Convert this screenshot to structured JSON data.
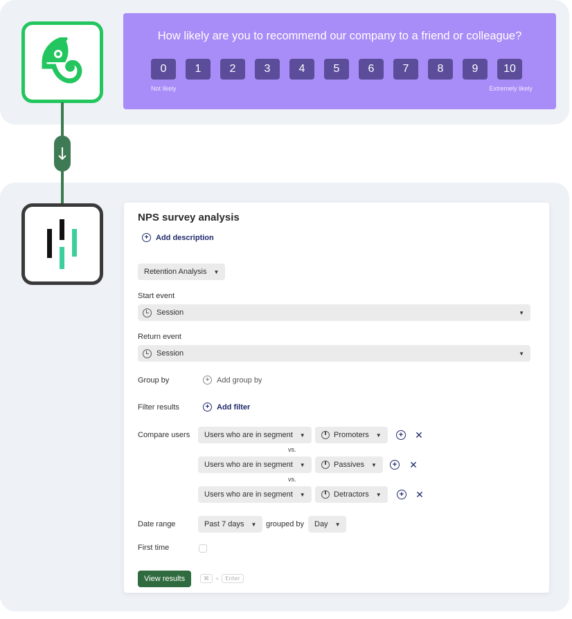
{
  "survey": {
    "question": "How likely are you to recommend our company to a friend or colleague?",
    "scores": [
      "0",
      "1",
      "2",
      "3",
      "4",
      "5",
      "6",
      "7",
      "8",
      "9",
      "10"
    ],
    "low_label": "Not likely",
    "high_label": "Extremely likely",
    "background_color": "#a88cf7",
    "button_color": "#5b4d9a"
  },
  "connector": {
    "icon": "arrow-down-icon"
  },
  "logos": {
    "top": "chameleon-logo-icon",
    "bottom": "heap-logo-icon"
  },
  "analysis": {
    "title": "NPS survey analysis",
    "add_description": "Add description",
    "analysis_type": "Retention Analysis",
    "start_event_label": "Start event",
    "start_event_value": "Session",
    "return_event_label": "Return event",
    "return_event_value": "Session",
    "group_by_label": "Group by",
    "add_group_by": "Add group by",
    "filter_label": "Filter results",
    "add_filter": "Add filter",
    "compare_label": "Compare users",
    "vs_label": "vs.",
    "segments": [
      {
        "condition": "Users who are in segment",
        "segment": "Promoters"
      },
      {
        "condition": "Users who are in segment",
        "segment": "Passives"
      },
      {
        "condition": "Users who are in segment",
        "segment": "Detractors"
      }
    ],
    "date_range_label": "Date range",
    "date_range_value": "Past 7 days",
    "grouped_by_label": "grouped by",
    "grouped_by_value": "Day",
    "first_time_label": "First time",
    "first_time_checked": false,
    "view_results": "View results",
    "shortcut": [
      "⌘",
      "+",
      "Enter"
    ],
    "primary_color": "#2f6b3e"
  }
}
